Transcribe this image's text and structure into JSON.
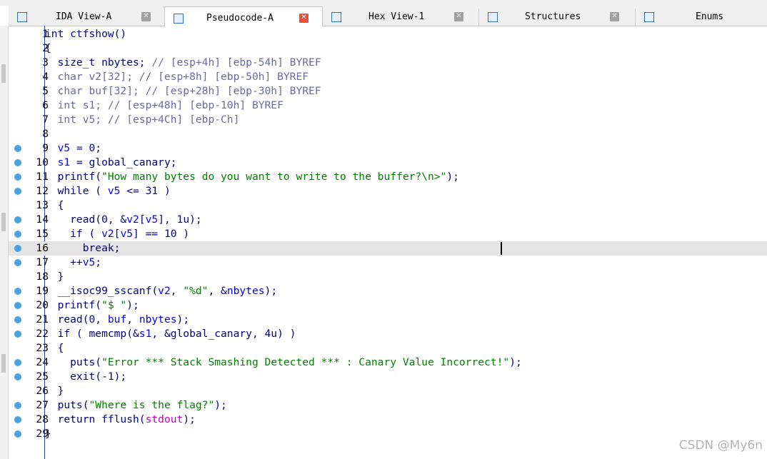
{
  "tabs": [
    {
      "label": "IDA View-A",
      "icon": "ida-view-icon",
      "active": false
    },
    {
      "label": "Pseudocode-A",
      "icon": "pseudocode-icon",
      "active": true
    },
    {
      "label": "Hex View-1",
      "icon": "hex-view-icon",
      "active": false
    },
    {
      "label": "Structures",
      "icon": "structures-icon",
      "active": false
    },
    {
      "label": "Enums",
      "icon": "enums-icon",
      "active": false
    }
  ],
  "close_glyph": "✕",
  "colors": {
    "keyword": "#000080",
    "variable": "#0000ff",
    "comment": "#6a6aa8",
    "string": "#008000",
    "breakpoint_dot": "#4aa3e0",
    "highlight_line": "#e4e4e4",
    "active_close": "#e8503a"
  },
  "highlighted_line": 16,
  "code": [
    {
      "n": "1",
      "dot": false,
      "t": [
        {
          "c": "g",
          "s": "int ctfshow()"
        }
      ]
    },
    {
      "n": "2",
      "dot": false,
      "t": [
        {
          "c": "g",
          "s": "{"
        }
      ]
    },
    {
      "n": "3",
      "dot": false,
      "t": [
        {
          "c": "g",
          "s": "  size_t nbytes; "
        },
        {
          "c": "c",
          "s": "// [esp+4h] [ebp-54h] BYREF"
        }
      ]
    },
    {
      "n": "4",
      "dot": false,
      "t": [
        {
          "c": "c",
          "s": "  char v2[32]; // [esp+8h] [ebp-50h] BYREF"
        }
      ]
    },
    {
      "n": "5",
      "dot": false,
      "t": [
        {
          "c": "c",
          "s": "  char buf[32]; // [esp+28h] [ebp-30h] BYREF"
        }
      ]
    },
    {
      "n": "6",
      "dot": false,
      "t": [
        {
          "c": "c",
          "s": "  int s1; // [esp+48h] [ebp-10h] BYREF"
        }
      ]
    },
    {
      "n": "7",
      "dot": false,
      "t": [
        {
          "c": "c",
          "s": "  int v5; // [esp+4Ch] [ebp-Ch]"
        }
      ]
    },
    {
      "n": "8",
      "dot": false,
      "t": []
    },
    {
      "n": "9",
      "dot": true,
      "t": [
        {
          "c": "g",
          "s": "  "
        },
        {
          "c": "v",
          "s": "v5"
        },
        {
          "c": "g",
          "s": " = 0;"
        }
      ]
    },
    {
      "n": "10",
      "dot": true,
      "t": [
        {
          "c": "g",
          "s": "  "
        },
        {
          "c": "v",
          "s": "s1"
        },
        {
          "c": "g",
          "s": " = global_canary;"
        }
      ]
    },
    {
      "n": "11",
      "dot": true,
      "t": [
        {
          "c": "g",
          "s": "  printf("
        },
        {
          "c": "n",
          "s": "\"How many bytes do you want to write to the buffer?\\n>\""
        },
        {
          "c": "g",
          "s": ");"
        }
      ]
    },
    {
      "n": "12",
      "dot": true,
      "t": [
        {
          "c": "g",
          "s": "  while ( "
        },
        {
          "c": "v",
          "s": "v5"
        },
        {
          "c": "g",
          "s": " <= 31 )"
        }
      ]
    },
    {
      "n": "13",
      "dot": false,
      "t": [
        {
          "c": "g",
          "s": "  {"
        }
      ]
    },
    {
      "n": "14",
      "dot": true,
      "t": [
        {
          "c": "g",
          "s": "    read(0, &"
        },
        {
          "c": "v",
          "s": "v2"
        },
        {
          "c": "g",
          "s": "["
        },
        {
          "c": "v",
          "s": "v5"
        },
        {
          "c": "g",
          "s": "], 1u);"
        }
      ]
    },
    {
      "n": "15",
      "dot": true,
      "t": [
        {
          "c": "g",
          "s": "    if ( "
        },
        {
          "c": "v",
          "s": "v2"
        },
        {
          "c": "g",
          "s": "["
        },
        {
          "c": "v",
          "s": "v5"
        },
        {
          "c": "g",
          "s": "] == 10 )"
        }
      ]
    },
    {
      "n": "16",
      "dot": true,
      "t": [
        {
          "c": "g",
          "s": "      break;"
        }
      ]
    },
    {
      "n": "17",
      "dot": true,
      "t": [
        {
          "c": "g",
          "s": "    ++"
        },
        {
          "c": "v",
          "s": "v5"
        },
        {
          "c": "g",
          "s": ";"
        }
      ]
    },
    {
      "n": "18",
      "dot": false,
      "t": [
        {
          "c": "g",
          "s": "  }"
        }
      ]
    },
    {
      "n": "19",
      "dot": true,
      "t": [
        {
          "c": "g",
          "s": "  __isoc99_sscanf("
        },
        {
          "c": "v",
          "s": "v2"
        },
        {
          "c": "g",
          "s": ", "
        },
        {
          "c": "n",
          "s": "\"%d\""
        },
        {
          "c": "g",
          "s": ", &"
        },
        {
          "c": "v",
          "s": "nbytes"
        },
        {
          "c": "g",
          "s": ");"
        }
      ]
    },
    {
      "n": "20",
      "dot": true,
      "t": [
        {
          "c": "g",
          "s": "  printf("
        },
        {
          "c": "n",
          "s": "\"$ \""
        },
        {
          "c": "g",
          "s": ");"
        }
      ]
    },
    {
      "n": "21",
      "dot": true,
      "t": [
        {
          "c": "g",
          "s": "  read(0, "
        },
        {
          "c": "v",
          "s": "buf"
        },
        {
          "c": "g",
          "s": ", "
        },
        {
          "c": "v",
          "s": "nbytes"
        },
        {
          "c": "g",
          "s": ");"
        }
      ]
    },
    {
      "n": "22",
      "dot": true,
      "t": [
        {
          "c": "g",
          "s": "  if ( memcmp(&"
        },
        {
          "c": "v",
          "s": "s1"
        },
        {
          "c": "g",
          "s": ", &global_canary, 4u) )"
        }
      ]
    },
    {
      "n": "23",
      "dot": false,
      "t": [
        {
          "c": "g",
          "s": "  {"
        }
      ]
    },
    {
      "n": "24",
      "dot": true,
      "t": [
        {
          "c": "g",
          "s": "    puts("
        },
        {
          "c": "n",
          "s": "\"Error *** Stack Smashing Detected *** : Canary Value Incorrect!\""
        },
        {
          "c": "g",
          "s": ");"
        }
      ]
    },
    {
      "n": "25",
      "dot": true,
      "t": [
        {
          "c": "g",
          "s": "    exit(-1);"
        }
      ]
    },
    {
      "n": "26",
      "dot": false,
      "t": [
        {
          "c": "g",
          "s": "  }"
        }
      ]
    },
    {
      "n": "27",
      "dot": true,
      "t": [
        {
          "c": "g",
          "s": "  puts("
        },
        {
          "c": "n",
          "s": "\"Where is the flag?\""
        },
        {
          "c": "g",
          "s": ");"
        }
      ]
    },
    {
      "n": "28",
      "dot": true,
      "t": [
        {
          "c": "g",
          "s": "  return fflush("
        },
        {
          "c": "f",
          "s": "stdout"
        },
        {
          "c": "g",
          "s": ");"
        }
      ]
    },
    {
      "n": "29",
      "dot": true,
      "t": [
        {
          "c": "g",
          "s": "}"
        }
      ]
    }
  ],
  "watermark": "CSDN @My6n"
}
